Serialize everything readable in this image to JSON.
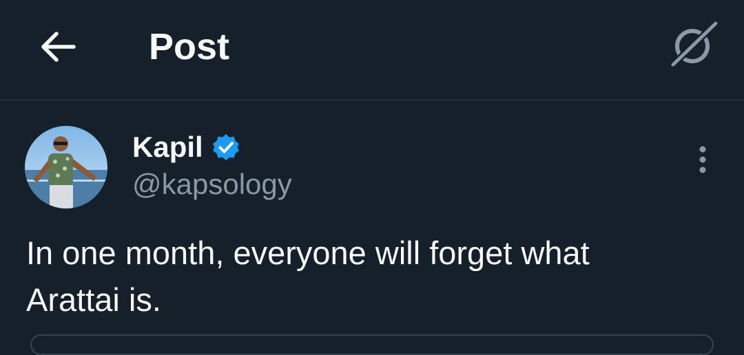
{
  "header": {
    "title": "Post",
    "back_icon": "arrow-left-icon",
    "grok_icon": "grok-icon"
  },
  "post": {
    "author": {
      "name": "Kapil",
      "handle": "@kapsology",
      "verified": true,
      "verified_icon": "verified-badge-icon"
    },
    "text": "In one month, everyone will forget what\nArattai is.",
    "more_icon": "more-vertical-icon"
  },
  "colors": {
    "background": "#15202b",
    "text": "#f7f9f9",
    "secondary_text": "#8b98a5",
    "divider": "#38444d",
    "verified": "#1d9bf0"
  }
}
